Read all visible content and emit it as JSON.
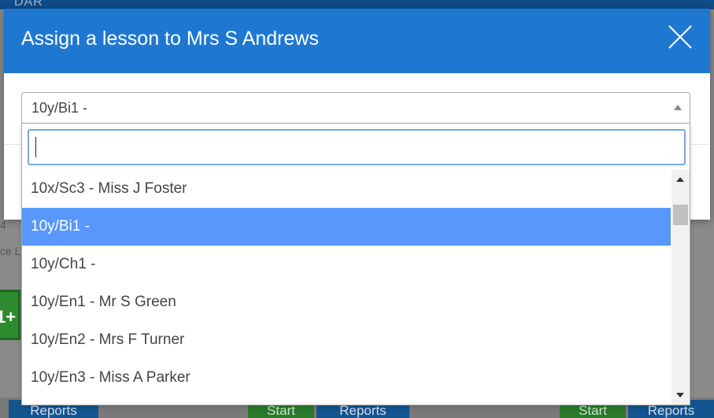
{
  "background": {
    "header_text": "DAR",
    "left_fragments": [
      "4",
      "ce L"
    ],
    "green_badge": "1+",
    "buttons": {
      "reports_1": "Reports",
      "start_1": "Start",
      "reports_2": "Reports",
      "start_2": "Start",
      "reports_3": "Reports"
    }
  },
  "modal": {
    "title": "Assign a lesson to Mrs S Andrews",
    "select": {
      "value": "10y/Bi1 -",
      "search_value": ""
    },
    "options": [
      {
        "label": "10x/Sc3 - Miss J Foster",
        "selected": false
      },
      {
        "label": "10y/Bi1 -",
        "selected": true
      },
      {
        "label": "10y/Ch1 -",
        "selected": false
      },
      {
        "label": "10y/En1 - Mr S Green",
        "selected": false
      },
      {
        "label": "10y/En2 - Mrs F Turner",
        "selected": false
      },
      {
        "label": "10y/En3 - Miss A Parker",
        "selected": false
      }
    ]
  },
  "icons": {
    "close": "close-icon",
    "select_arrow": "triangle-up-icon",
    "scroll_up": "scroll-up-icon",
    "scroll_down": "scroll-down-icon"
  },
  "colors": {
    "header": "#1e78d2",
    "selected_option": "#5897fb",
    "search_focus": "#7aa7e0"
  }
}
